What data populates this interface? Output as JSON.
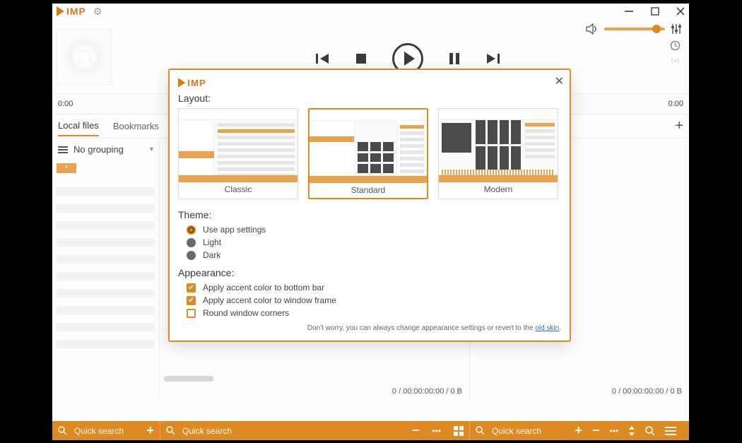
{
  "app": {
    "name": "IMP"
  },
  "window": {
    "minimize": "–",
    "maximize": "▢",
    "close": "✕"
  },
  "timeline": {
    "left": "0:00",
    "right": "0:00"
  },
  "tabs": {
    "local": "Local files",
    "bookmarks": "Bookmarks"
  },
  "sidebar": {
    "grouping": "No grouping",
    "star": "*"
  },
  "stats": {
    "mid": "0 / 00:00:00:00 / 0 B",
    "right": "0 / 00:00:00:00 / 0 B"
  },
  "search": {
    "placeholder": "Quick search"
  },
  "dialog": {
    "layout_label": "Layout:",
    "layouts": {
      "classic": "Classic",
      "standard": "Standard",
      "modern": "Modern"
    },
    "theme_label": "Theme:",
    "theme": {
      "app": "Use app settings",
      "light": "Light",
      "dark": "Dark"
    },
    "appearance_label": "Appearance:",
    "appearance": {
      "accent_bottom": "Apply accent color to bottom bar",
      "accent_frame": "Apply accent color to window frame",
      "round_corners": "Round window corners"
    },
    "hint_pre": "Don't worry, you can always change appearance settings or revert to the ",
    "hint_link": "old skin",
    "hint_post": "."
  }
}
